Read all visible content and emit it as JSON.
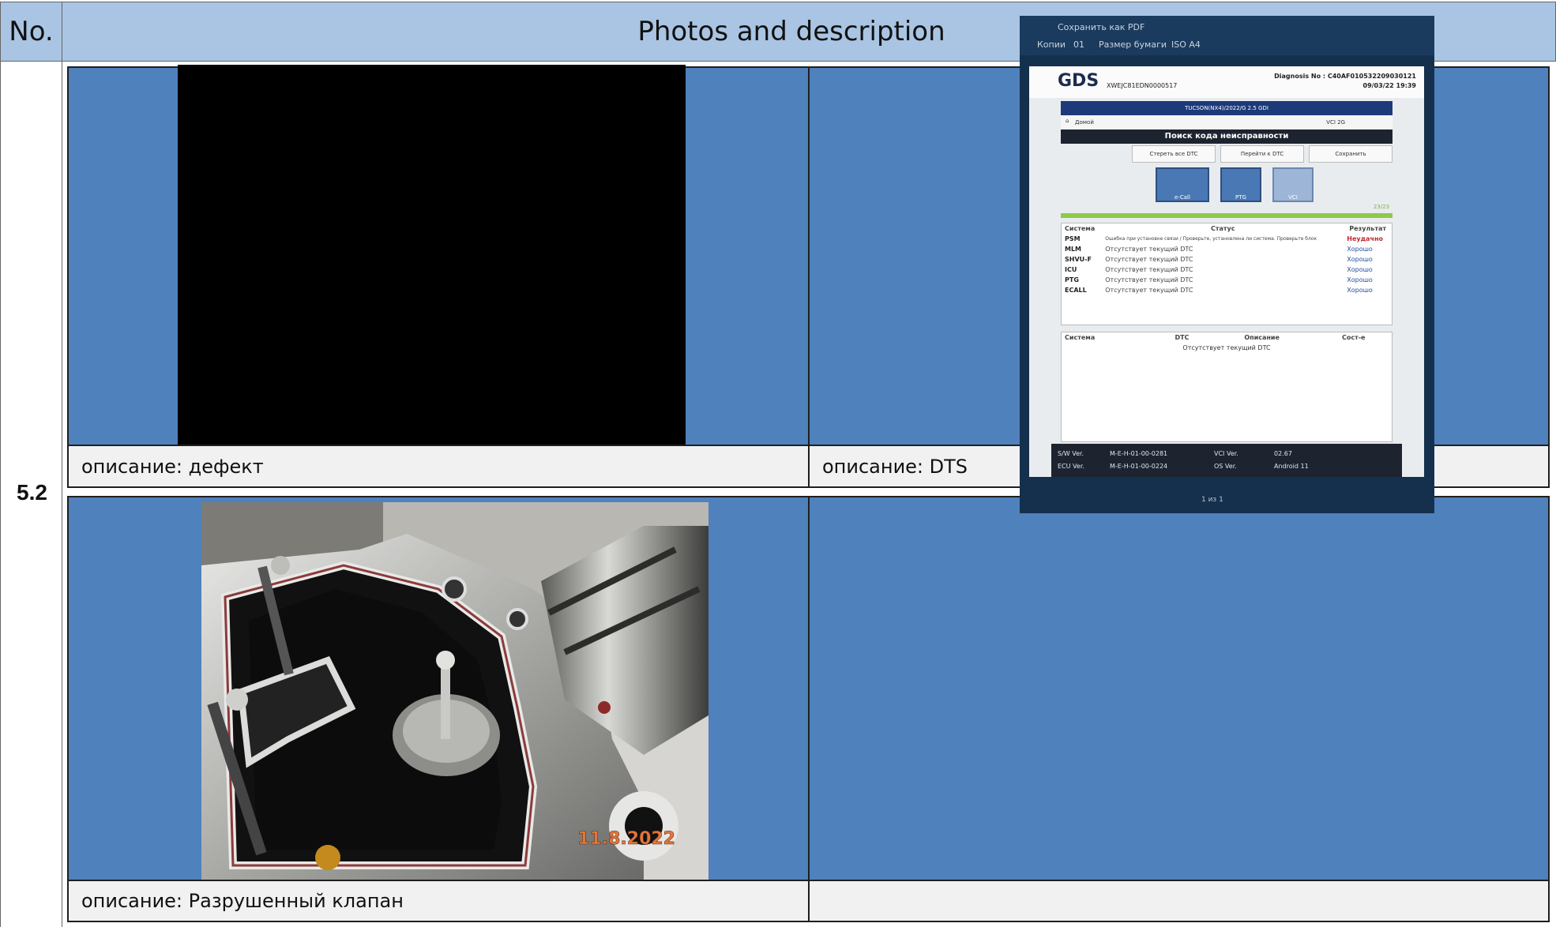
{
  "header": {
    "no_label": "No.",
    "title": "Photos and description"
  },
  "row_number": "5.2",
  "cells": {
    "top_left_caption": "описание: дефект",
    "top_right_caption": "описание: DTS",
    "bottom_left_caption": "описание: Разрушенный клапан",
    "bottom_right_caption": ""
  },
  "photo_timestamp": "11.8.2022",
  "scan_tool": {
    "print_title": "Сохранить как PDF",
    "copies_label": "Копии",
    "copies_value": "01",
    "paper_label": "Размер бумаги",
    "paper_value": "ISO A4",
    "logo": "GDS",
    "vin": "XWEJC81EDN0000517",
    "diagnosis_no": "Diagnosis No : C40AF010532209030121",
    "date": "09/03/22 19:39",
    "vehicle": "TUCSON(NX4)/2022/G 2.5 GDI",
    "home_label": "Домой",
    "vci_label": "VCI 2G",
    "screen_title": "Поиск кода неисправности",
    "buttons": [
      "Стереть все DTC",
      "Перейти к DTC",
      "Сохранить"
    ],
    "modules": [
      "e-Call",
      "PTG",
      "VCI"
    ],
    "progress_value": "23/23",
    "columns": [
      "Система",
      "Статус",
      "Результат"
    ],
    "rows": [
      {
        "system": "PSM",
        "status": "Ошибка при установке связи / Проверьте, установлена ли система. Проверьте блок",
        "result": "Неудачно"
      },
      {
        "system": "MLM",
        "status": "Отсутствует текущий DTC",
        "result": "Хорошо"
      },
      {
        "system": "SHVU-F",
        "status": "Отсутствует текущий DTC",
        "result": "Хорошо"
      },
      {
        "system": "ICU",
        "status": "Отсутствует текущий DTC",
        "result": "Хорошо"
      },
      {
        "system": "PTG",
        "status": "Отсутствует текущий DTC",
        "result": "Хорошо"
      },
      {
        "system": "ECALL",
        "status": "Отсутствует текущий DTC",
        "result": "Хорошо"
      }
    ],
    "dtc_columns": [
      "Система",
      "DTC",
      "Описание",
      "Сост-е"
    ],
    "dtc_empty": "Отсутствует текущий DTC",
    "footer": {
      "sw_label": "S/W Ver.",
      "sw_value": "M-E-H-01-00-0281",
      "ecu_label": "ECU Ver.",
      "ecu_value": "M-E-H-01-00-0224",
      "vci_label": "VCI Ver.",
      "vci_value": "02.67",
      "os_label": "OS Ver.",
      "os_value": "Android 11",
      "page": "1 из 1"
    }
  },
  "colors": {
    "header_bg": "#a9c5e3",
    "cell_blue": "#4f81bd",
    "caption_bg": "#f1f1f1",
    "fail_red": "#c0282d",
    "good_blue": "#1f4f9e"
  }
}
